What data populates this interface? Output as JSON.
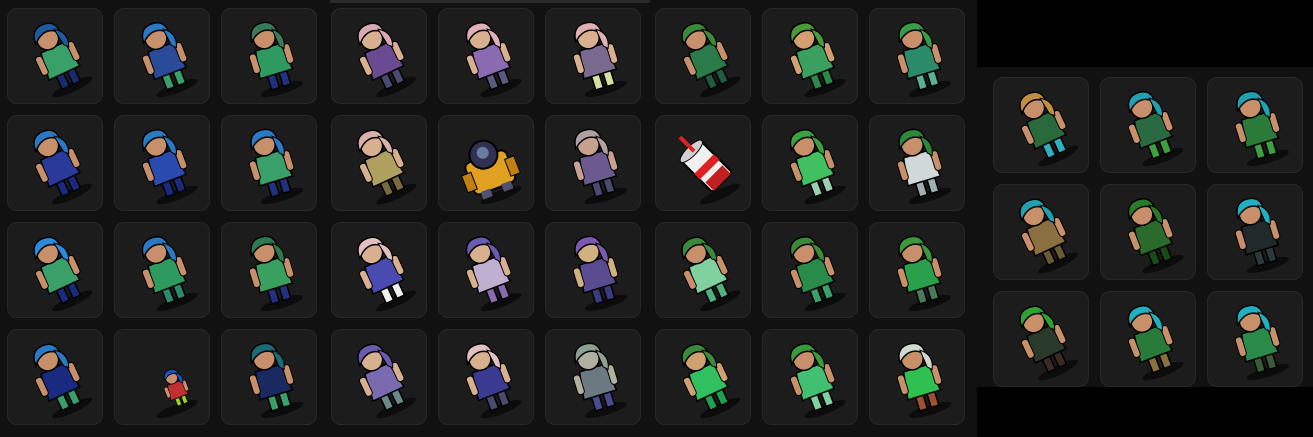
{
  "left_grid": {
    "rows": [
      [
        {
          "name": "sprite-blue-hair-green-outfit",
          "hair": "#1e5a9e",
          "outfit": "#3aa06a",
          "pants": "#1a2a70",
          "skin": "#c8906a"
        },
        {
          "name": "sprite-blue-hair-green-pants",
          "hair": "#2a79c5",
          "outfit": "#2a4a9a",
          "pants": "#3aa06a",
          "skin": "#c8906a"
        },
        {
          "name": "sprite-green-hat-blue-pants",
          "hair": "#3a7a5a",
          "outfit": "#2e9a60",
          "pants": "#223080",
          "skin": "#c8906a"
        },
        {
          "name": "sprite-pink-hair-purple-dress",
          "hair": "#d8a8b4",
          "outfit": "#6a4a90",
          "pants": "#4a4a70",
          "skin": "#d8b090"
        },
        {
          "name": "sprite-pink-hair-lavender-dress",
          "hair": "#e0b0b8",
          "outfit": "#8a6ab0",
          "pants": "#5a5a80",
          "skin": "#d8b090"
        },
        {
          "name": "sprite-pink-hair-yellow-skirt",
          "hair": "#e0b0b0",
          "outfit": "#7a6a90",
          "pants": "#d8e0a0",
          "skin": "#d8b090"
        },
        {
          "name": "sprite-green-hair-green-suit",
          "hair": "#3a8a3a",
          "outfit": "#2a7a4a",
          "pants": "#225a40",
          "skin": "#c8906a"
        },
        {
          "name": "sprite-green-hair-green-skirt",
          "hair": "#4a9a3a",
          "outfit": "#3aa060",
          "pants": "#2a8a4a",
          "skin": "#d0a070"
        },
        {
          "name": "sprite-green-hair-teal-outfit",
          "hair": "#3a9a4a",
          "outfit": "#2a8a6a",
          "pants": "#5ab090",
          "skin": "#c8906a"
        }
      ],
      [
        {
          "name": "sprite-blue-hair-navy-gown",
          "hair": "#2a79c5",
          "outfit": "#2a3a9a",
          "pants": "#1a2a80",
          "skin": "#c8906a"
        },
        {
          "name": "sprite-blue-hair-blue-dress",
          "hair": "#2a79c5",
          "outfit": "#2a4ab0",
          "pants": "#1a2a80",
          "skin": "#c8906a"
        },
        {
          "name": "sprite-blue-hair-green-top",
          "hair": "#2a79c5",
          "outfit": "#3aa06a",
          "pants": "#223080",
          "skin": "#c8906a"
        },
        {
          "name": "sprite-pink-hair-tan-robe",
          "hair": "#d8b0a8",
          "outfit": "#b0a060",
          "pants": "#7a6a40",
          "skin": "#d8b090"
        },
        {
          "name": "sprite-orange-mech-robot",
          "hair": "#303050",
          "outfit": "#e0a020",
          "pants": "#505070",
          "skin": "#f0c040",
          "special": "robot"
        },
        {
          "name": "sprite-hooded-purple-outfit",
          "hair": "#b0a0a0",
          "outfit": "#6a5a90",
          "pants": "#4a4a70",
          "skin": "#c8a090"
        },
        {
          "name": "sprite-red-white-drink-cup",
          "hair": "#e02020",
          "outfit": "#f0f0f0",
          "pants": "#c02020",
          "skin": "#ffffff",
          "special": "cup"
        },
        {
          "name": "sprite-green-hair-mint-outfit",
          "hair": "#3aa040",
          "outfit": "#40c060",
          "pants": "#9ad0b0",
          "skin": "#c8906a"
        },
        {
          "name": "sprite-red-ribbon-white-dress",
          "hair": "#2a8a3a",
          "outfit": "#d0d8d8",
          "pants": "#a0b0b0",
          "skin": "#c8906a"
        }
      ],
      [
        {
          "name": "sprite-spiky-blue-hair",
          "hair": "#2a8ae0",
          "outfit": "#3aa06a",
          "pants": "#1a2a80",
          "skin": "#c8906a"
        },
        {
          "name": "sprite-blue-hair-green-coat",
          "hair": "#2a79c5",
          "outfit": "#2e9a60",
          "pants": "#2a8a6a",
          "skin": "#c8906a"
        },
        {
          "name": "sprite-green-hood-armored",
          "hair": "#2e7a50",
          "outfit": "#3aa060",
          "pants": "#223080",
          "skin": "#c8906a"
        },
        {
          "name": "sprite-pink-hair-indigo-dress",
          "hair": "#e0c0c0",
          "outfit": "#4a4ab0",
          "pants": "#f0f0f0",
          "skin": "#d8b090"
        },
        {
          "name": "sprite-purple-hat-striped",
          "hair": "#6a5ab0",
          "outfit": "#c0b0d0",
          "pants": "#8a6ab0",
          "skin": "#d8b090"
        },
        {
          "name": "sprite-purple-hood-robe",
          "hair": "#7a5ab0",
          "outfit": "#5a4a90",
          "pants": "#3a3a80",
          "skin": "#d0b080"
        },
        {
          "name": "sprite-green-hair-mint-dress",
          "hair": "#3a8a3a",
          "outfit": "#80d0a0",
          "pants": "#50b080",
          "skin": "#c8906a"
        },
        {
          "name": "sprite-green-hair-green-tunic",
          "hair": "#3a8a3a",
          "outfit": "#2a8a4a",
          "pants": "#3aa06a",
          "skin": "#c8906a"
        },
        {
          "name": "sprite-green-hair-olive-pants",
          "hair": "#3a9a3a",
          "outfit": "#2aa04a",
          "pants": "#4a7a5a",
          "skin": "#c8906a"
        }
      ],
      [
        {
          "name": "sprite-blue-ponytail-green-legs",
          "hair": "#2a79c5",
          "outfit": "#1a2a80",
          "pants": "#3aa06a",
          "skin": "#c8906a"
        },
        {
          "name": "sprite-tiny-blue-red-green",
          "hair": "#2050c0",
          "outfit": "#c03030",
          "pants": "#a0d020",
          "skin": "#c8906a",
          "special": "tiny"
        },
        {
          "name": "sprite-teal-hair-dark-outfit",
          "hair": "#1a6a7a",
          "outfit": "#1a2a60",
          "pants": "#3aa06a",
          "skin": "#c8906a"
        },
        {
          "name": "sprite-purple-hair-violet-dress",
          "hair": "#6a5ab0",
          "outfit": "#7a6ab0",
          "pants": "#6a8a8a",
          "skin": "#d8b090"
        },
        {
          "name": "sprite-pink-hair-navy-skirt",
          "hair": "#e0c0c0",
          "outfit": "#3a3a90",
          "pants": "#4a4a70",
          "skin": "#d8b090"
        },
        {
          "name": "sprite-grey-hair-grey-dress",
          "hair": "#8aa090",
          "outfit": "#6a7a80",
          "pants": "#4a4a90",
          "skin": "#b0b0a0"
        },
        {
          "name": "sprite-green-hair-green-apron",
          "hair": "#3a8a3a",
          "outfit": "#30c060",
          "pants": "#20a050",
          "skin": "#d0a070"
        },
        {
          "name": "sprite-green-hair-flowing-robe",
          "hair": "#3a9a3a",
          "outfit": "#40c070",
          "pants": "#80d0a0",
          "skin": "#c8906a"
        },
        {
          "name": "sprite-white-cat-green-dress",
          "hair": "#d0d8d0",
          "outfit": "#30c050",
          "pants": "#a05030",
          "skin": "#c8906a"
        }
      ]
    ]
  },
  "right_grid": {
    "rows": [
      [
        {
          "name": "sprite-straw-hat-teal",
          "hair": "#c09040",
          "outfit": "#2a6a3a",
          "pants": "#30b0c0",
          "skin": "#c8906a"
        },
        {
          "name": "sprite-teal-hair-green-outfit",
          "hair": "#20a0b0",
          "outfit": "#2a6a40",
          "pants": "#40a040",
          "skin": "#c8906a"
        },
        {
          "name": "sprite-teal-hair-winged",
          "hair": "#20a0b0",
          "outfit": "#2a7a3a",
          "pants": "#3aa040",
          "skin": "#c8906a"
        }
      ],
      [
        {
          "name": "sprite-teal-hair-khaki-outfit",
          "hair": "#20a0b0",
          "outfit": "#8a7040",
          "pants": "#6a5a30",
          "skin": "#c8906a"
        },
        {
          "name": "sprite-green-witch-staff",
          "hair": "#2a7a2a",
          "outfit": "#2a6a2a",
          "pants": "#1a4a1a",
          "skin": "#c8906a"
        },
        {
          "name": "sprite-teal-hair-black-outfit",
          "hair": "#20b0c0",
          "outfit": "#202a2a",
          "pants": "#2a3a3a",
          "skin": "#c8906a"
        }
      ],
      [
        {
          "name": "sprite-green-cap-dark-outfit",
          "hair": "#30a030",
          "outfit": "#2a3a2a",
          "pants": "#3a2a20",
          "skin": "#c8906a"
        },
        {
          "name": "sprite-teal-hair-striped-green",
          "hair": "#20b0c0",
          "outfit": "#2a7a3a",
          "pants": "#8a7040",
          "skin": "#c8906a"
        },
        {
          "name": "sprite-teal-hair-green-cape",
          "hair": "#20b0c0",
          "outfit": "#2a8a4a",
          "pants": "#3a5a3a",
          "skin": "#c8906a"
        }
      ]
    ]
  }
}
